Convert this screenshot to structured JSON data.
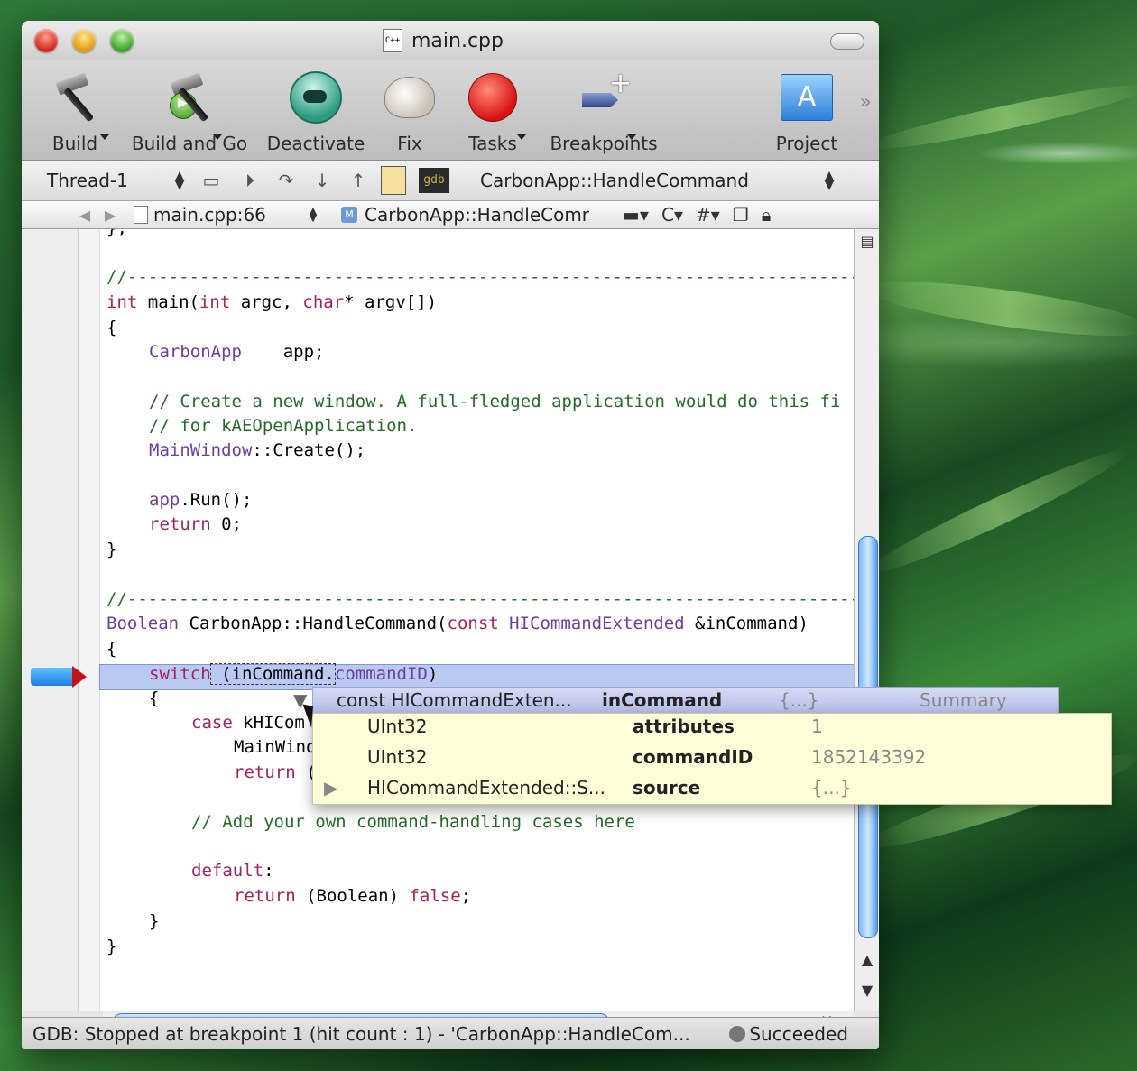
{
  "window": {
    "title": "main.cpp",
    "file_icon": "C++"
  },
  "toolbar": {
    "build": "Build",
    "build_and_go": "Build and Go",
    "deactivate": "Deactivate",
    "fix": "Fix",
    "tasks": "Tasks",
    "breakpoints": "Breakpoints",
    "project": "Project"
  },
  "debugbar": {
    "thread": "Thread-1",
    "gdb": "gdb",
    "frame": "CarbonApp::HandleCommand"
  },
  "navbar": {
    "file": "main.cpp:66",
    "function": "CarbonApp::HandleComr",
    "menu_c": "C",
    "menu_hash": "#"
  },
  "code": {
    "l0": "};",
    "l1": "//---------------------------------------------------------------------------",
    "l2a": "int",
    "l2b": " main(",
    "l2c": "int",
    "l2d": " argc, ",
    "l2e": "char",
    "l2f": "* argv[])",
    "l3": "{",
    "l4a": "CarbonApp",
    "l4b": "    app;",
    "l5": "// Create a new window. A full-fledged application would do this fi",
    "l6": "// for kAEOpenApplication.",
    "l7a": "MainWindow",
    "l7b": "::Create();",
    "l8a": "app",
    "l8b": ".Run();",
    "l9a": "return",
    "l9b": " 0;",
    "l10": "}",
    "l11": "//---------------------------------------------------------------------------",
    "l12a": "Boolean",
    "l12b": " CarbonApp::HandleCommand(",
    "l12c": "const",
    "l12d": " HICommandExtended",
    "l12e": " &inCommand)",
    "l13": "{",
    "l14a": "switch",
    "l14b": " (inCommand.",
    "l14c": "commandID",
    "l14d": ")",
    "l15": "{",
    "l16a": "case",
    "l16b": " kHICom",
    "l17": "MainWind",
    "l18a": "return",
    "l18b": " (",
    "l19": "// Add your own command-handling cases here",
    "l20a": "default",
    "l20b": ":",
    "l21a": "return",
    "l21b": " (Boolean) ",
    "l21c": "false",
    "l21d": ";",
    "l22": "}",
    "l23": "}"
  },
  "tooltip": {
    "header": {
      "type": "const HICommandExten...",
      "name": "inCommand",
      "value": "{...}",
      "summary": "Summary"
    },
    "rows": [
      {
        "type": "UInt32",
        "name": "attributes",
        "value": "1"
      },
      {
        "type": "UInt32",
        "name": "commandID",
        "value": "1852143392"
      },
      {
        "type": "HICommandExtended::S...",
        "name": "source",
        "value": "{...}"
      }
    ]
  },
  "status": {
    "text": "GDB: Stopped at breakpoint 1 (hit count : 1) - 'CarbonApp::HandleCom...",
    "result": "Succeeded"
  }
}
